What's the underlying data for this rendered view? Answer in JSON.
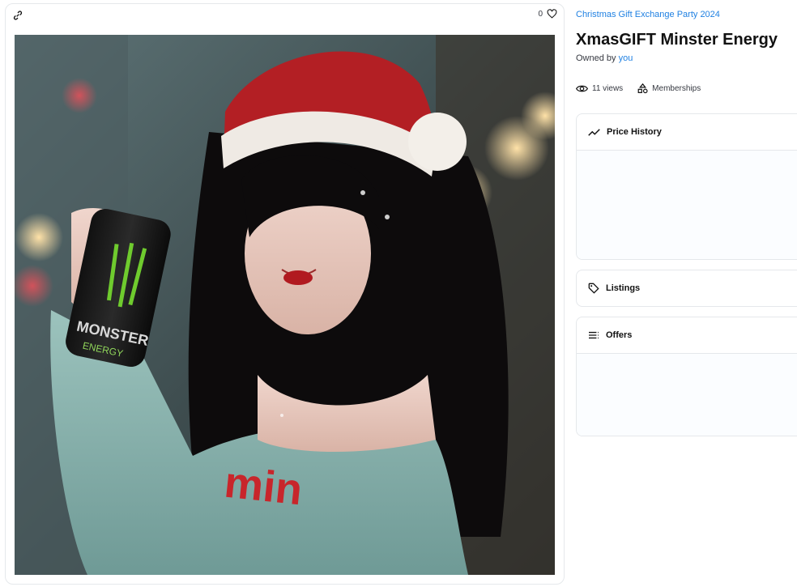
{
  "card": {
    "link_icon": "link-icon",
    "favorite_count": "0",
    "favorite_icon": "heart-icon"
  },
  "artwork": {
    "can_text_line1": "MONSTER",
    "can_text_line2": "ENERGY",
    "sweater_text": "min"
  },
  "item": {
    "collection": "Christmas Gift Exchange Party 2024",
    "title": "XmasGIFT Minster Energy",
    "owned_prefix": "Owned by",
    "owner": "you"
  },
  "stats": {
    "views": "11 views",
    "memberships": "Memberships"
  },
  "panels": {
    "price_history": "Price History",
    "listings": "Listings",
    "offers": "Offers"
  },
  "colors": {
    "accent": "#2081e2",
    "border": "#e5e8eb",
    "text": "#121212"
  }
}
